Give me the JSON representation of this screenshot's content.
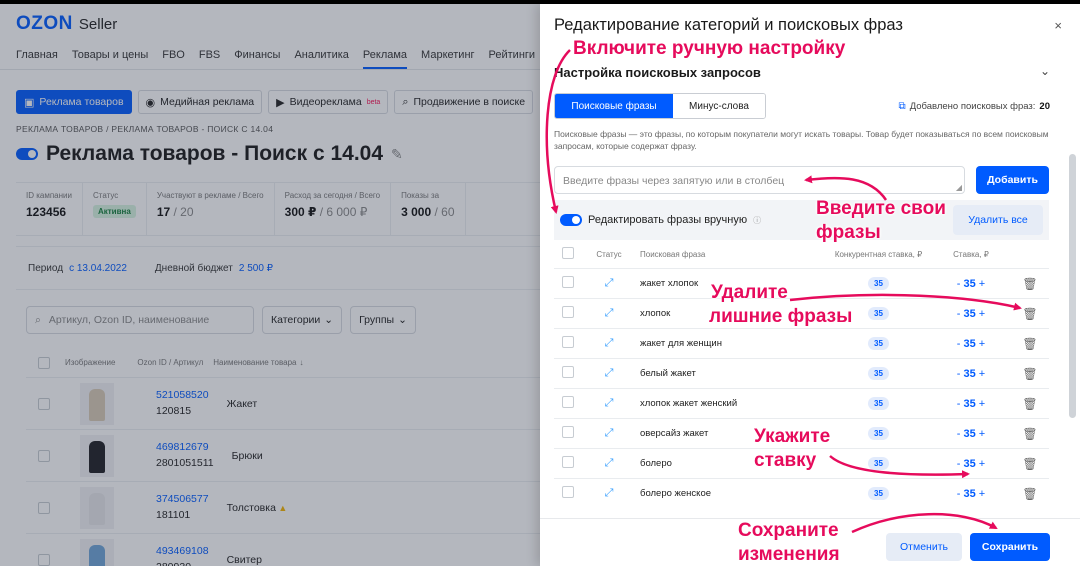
{
  "brand": {
    "name": "OZON",
    "suffix": "Seller"
  },
  "main_nav": [
    "Главная",
    "Товары и цены",
    "FBO",
    "FBS",
    "Финансы",
    "Аналитика",
    "Реклама",
    "Маркетинг",
    "Рейтинги"
  ],
  "main_nav_active": "Реклама",
  "ad_tabs": [
    {
      "label": "Реклама товаров",
      "icon": "cube-icon",
      "active": true
    },
    {
      "label": "Медийная реклама",
      "icon": "eye-icon",
      "active": false
    },
    {
      "label": "Видеореклама",
      "icon": "play-icon",
      "active": false,
      "badge": "beta"
    },
    {
      "label": "Продвижение в поиске",
      "icon": "search-trend-icon",
      "active": false
    }
  ],
  "breadcrumbs": [
    "РЕКЛАМА ТОВАРОВ",
    "/",
    "РЕКЛАМА ТОВАРОВ - ПОИСК С 14.04"
  ],
  "page_title": "Реклама товаров - Поиск с 14.04",
  "stats": [
    {
      "label": "ID кампании",
      "value": "123456"
    },
    {
      "label": "Статус",
      "value": "Активна"
    },
    {
      "label": "Участвуют в рекламе / Всего",
      "value": "17",
      "total": "/ 20"
    },
    {
      "label": "Расход за сегодня / Всего",
      "value": "300 ₽",
      "total": "/ 6 000 ₽"
    },
    {
      "label": "Показы за",
      "value": "3 000",
      "total": "/ 60"
    }
  ],
  "period": {
    "label": "Период",
    "value": "с 13.04.2022",
    "budget_label": "Дневной бюджет",
    "budget_value": "2 500 ₽"
  },
  "filters": {
    "search_placeholder": "Артикул, Ozon ID, наименование",
    "categories": "Категории",
    "groups": "Группы"
  },
  "product_table": {
    "headers": [
      "Изображение",
      "Ozon ID / Артикул",
      "Наименование товара"
    ],
    "rows": [
      {
        "ozon_id": "521058520",
        "sku": "120815",
        "name": "Жакет",
        "color": "#d9cbb6"
      },
      {
        "ozon_id": "469812679",
        "sku": "2801051511",
        "name": "Брюки",
        "color": "#1f1f24"
      },
      {
        "ozon_id": "374506577",
        "sku": "181101",
        "name": "Толстовка",
        "color": "#e7e7ea",
        "warn": true
      },
      {
        "ozon_id": "493469108",
        "sku": "280930",
        "name": "Свитер",
        "color": "#6fa5d8"
      }
    ]
  },
  "panel": {
    "title": "Редактирование категорий и поисковых фраз",
    "close": "×",
    "section": "Настройка поисковых запросов",
    "tabs": [
      "Поисковые фразы",
      "Минус-слова"
    ],
    "added_label": "Добавлено поисковых фраз:",
    "added_count": "20",
    "hint": "Поисковые фразы — это фразы, по которым покупатели могут искать товары. Товар будет показываться по всем поисковым запросам, которые содержат фразу.",
    "input_placeholder": "Введите фразы через запятую или в столбец",
    "add_button": "Добавить",
    "edit_manual_label": "Редактировать фразы вручную",
    "delete_all": "Удалить все",
    "table_headers": [
      "Статус",
      "Поисковая фраза",
      "Конкурентная ставка, ₽",
      "Ставка, ₽"
    ],
    "phrases": [
      {
        "phrase": "жакет хлопок",
        "competitor": "35",
        "bid": "35"
      },
      {
        "phrase": "хлопок",
        "competitor": "35",
        "bid": "35"
      },
      {
        "phrase": "жакет для женщин",
        "competitor": "35",
        "bid": "35"
      },
      {
        "phrase": "белый жакет",
        "competitor": "35",
        "bid": "35"
      },
      {
        "phrase": "хлопок жакет женский",
        "competitor": "35",
        "bid": "35"
      },
      {
        "phrase": "оверсайз жакет",
        "competitor": "35",
        "bid": "35"
      },
      {
        "phrase": "болеро",
        "competitor": "35",
        "bid": "35"
      },
      {
        "phrase": "болеро женское",
        "competitor": "35",
        "bid": "35"
      }
    ],
    "cancel": "Отменить",
    "save": "Сохранить"
  },
  "annotations": {
    "manual": "Включите ручную настройку",
    "enter_1": "Введите свои",
    "enter_2": "фразы",
    "delete_1": "Удалите",
    "delete_2": "лишние фразы",
    "bid_1": "Укажите",
    "bid_2": "ставку",
    "save_1": "Сохраните",
    "save_2": "изменения",
    "color": "#e60b5c"
  }
}
